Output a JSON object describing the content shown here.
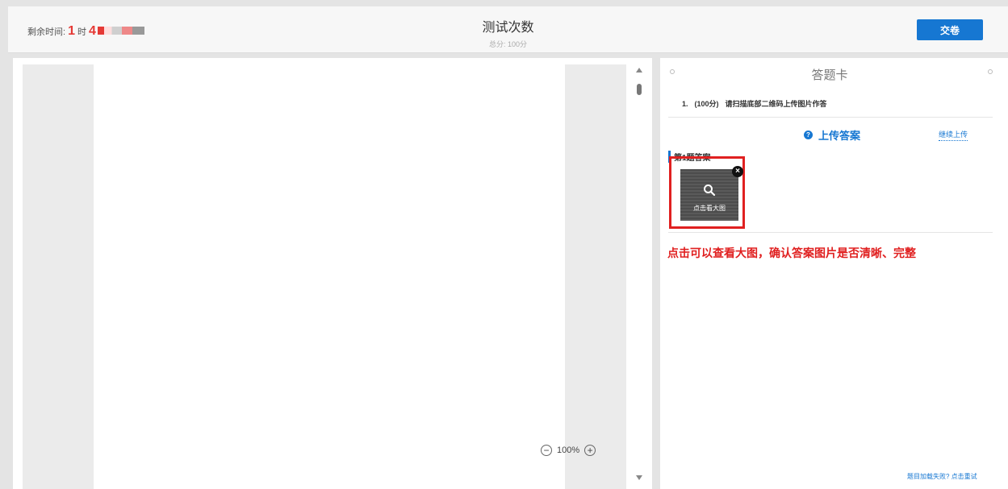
{
  "header": {
    "timer_label": "剩余时间:",
    "timer_hours": "1",
    "timer_hours_unit": "时",
    "timer_minutes": "4",
    "title": "测试次数",
    "subtitle": "总分: 100分",
    "submit_label": "交卷"
  },
  "viewer": {
    "zoom_level": "100%",
    "zoom_out_glyph": "−",
    "zoom_in_glyph": "+"
  },
  "answer_card": {
    "title": "答题卡",
    "question_number": "1.",
    "question_score": "(100分)",
    "question_text": "请扫描底部二维码上传图片作答",
    "upload_title": "上传答案",
    "upload_help_glyph": "?",
    "continue_upload": "继续上传",
    "answer_label": "第1题答案",
    "thumbnail_caption": "点击看大图",
    "close_glyph": "×",
    "hint": "点击可以查看大图，确认答案图片是否清晰、完整",
    "reload_link": "题目加载失败? 点击重试"
  },
  "colors": {
    "accent": "#1677d2",
    "highlight": "#e02020",
    "timer": "#e53935"
  },
  "icons": [
    "search-icon",
    "close-icon",
    "help-icon",
    "zoom-out-icon",
    "zoom-in-icon"
  ]
}
